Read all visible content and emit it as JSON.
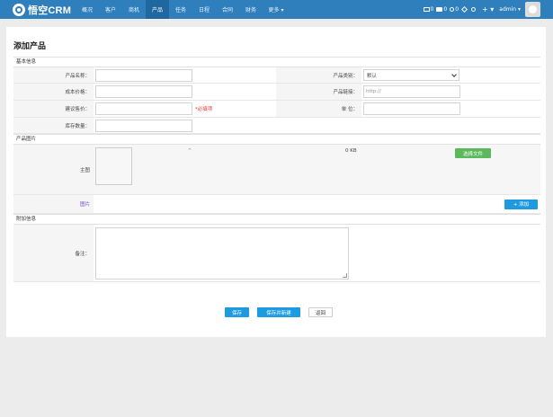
{
  "app": {
    "logo_text": "悟空CRM"
  },
  "nav": {
    "items": [
      {
        "label": "概况"
      },
      {
        "label": "客户"
      },
      {
        "label": "商机"
      },
      {
        "label": "产品",
        "active": true
      },
      {
        "label": "任务"
      },
      {
        "label": "日程"
      },
      {
        "label": "合同"
      },
      {
        "label": "财务"
      },
      {
        "label": "更多 ▾"
      }
    ]
  },
  "topright": {
    "mail_count": "0",
    "chat_count": "0",
    "notice_count": "0",
    "admin_label": "admin ▾",
    "plus_label": "+ ▾"
  },
  "page": {
    "title": "添加产品"
  },
  "sections": {
    "basic": "基本信息",
    "product_image": "产品图片",
    "extra": "附加信息"
  },
  "fields": {
    "product_name": {
      "label": "产品名称：",
      "value": ""
    },
    "product_category": {
      "label": "产品类别：",
      "selected": "默认"
    },
    "cost_price": {
      "label": "成本价格：",
      "value": ""
    },
    "product_link": {
      "label": "产品链接：",
      "placeholder": "http://"
    },
    "suggested_price": {
      "label": "建议售价：",
      "value": "",
      "required_hint": "*必填项"
    },
    "unit": {
      "label": "单 位：",
      "value": ""
    },
    "stock": {
      "label": "库存数量：",
      "value": ""
    },
    "main_image": {
      "label": "主图",
      "caption": "^",
      "size_text": "0 KB",
      "choose_button": "选择文件"
    },
    "gallery_label": "图片",
    "add_button": "+ 添加",
    "remark": {
      "label": "备注：",
      "value": ""
    }
  },
  "footer": {
    "save_button": "保存",
    "save_new_button": "保存并新建",
    "back_button": "返回"
  }
}
